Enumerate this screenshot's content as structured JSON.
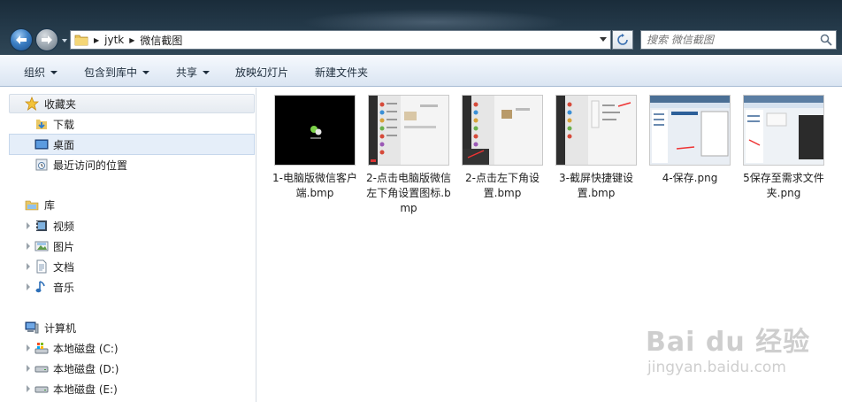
{
  "window": {
    "address": {
      "crumbs": [
        "jytk",
        "微信截图"
      ]
    },
    "search": {
      "placeholder": "搜索 微信截图"
    }
  },
  "toolbar": {
    "items": [
      {
        "label": "组织",
        "dropdown": true
      },
      {
        "label": "包含到库中",
        "dropdown": true
      },
      {
        "label": "共享",
        "dropdown": true
      },
      {
        "label": "放映幻灯片",
        "dropdown": false
      },
      {
        "label": "新建文件夹",
        "dropdown": false
      }
    ]
  },
  "sidebar": {
    "favorites": {
      "label": "收藏夹",
      "items": [
        {
          "label": "下载",
          "icon": "download-folder-icon"
        },
        {
          "label": "桌面",
          "icon": "desktop-icon",
          "selected": true
        },
        {
          "label": "最近访问的位置",
          "icon": "recent-places-icon"
        }
      ]
    },
    "libraries": {
      "label": "库",
      "items": [
        {
          "label": "视频",
          "icon": "video-library-icon"
        },
        {
          "label": "图片",
          "icon": "pictures-library-icon"
        },
        {
          "label": "文档",
          "icon": "documents-library-icon"
        },
        {
          "label": "音乐",
          "icon": "music-library-icon"
        }
      ]
    },
    "computer": {
      "label": "计算机",
      "items": [
        {
          "label": "本地磁盘 (C:)",
          "icon": "system-drive-icon"
        },
        {
          "label": "本地磁盘 (D:)",
          "icon": "drive-icon"
        },
        {
          "label": "本地磁盘 (E:)",
          "icon": "drive-icon"
        }
      ]
    }
  },
  "files": [
    {
      "name": "1-电脑版微信客户端.bmp",
      "thumb": "black"
    },
    {
      "name": "2-点击电脑版微信左下角设置图标.bmp",
      "thumb": "wechat"
    },
    {
      "name": "2-点击左下角设置.bmp",
      "thumb": "wechat-menu"
    },
    {
      "name": "3-截屏快捷键设置.bmp",
      "thumb": "settings"
    },
    {
      "name": "4-保存.png",
      "thumb": "explorer"
    },
    {
      "name": "5保存至需求文件夹.png",
      "thumb": "explorer2"
    }
  ],
  "watermark": {
    "brand": "Bai du 经验",
    "url": "jingyan.baidu.com"
  },
  "colors": {
    "accent": "#3c7fc4",
    "selection": "#e5eef9",
    "toolbar": "#dae5f2"
  }
}
